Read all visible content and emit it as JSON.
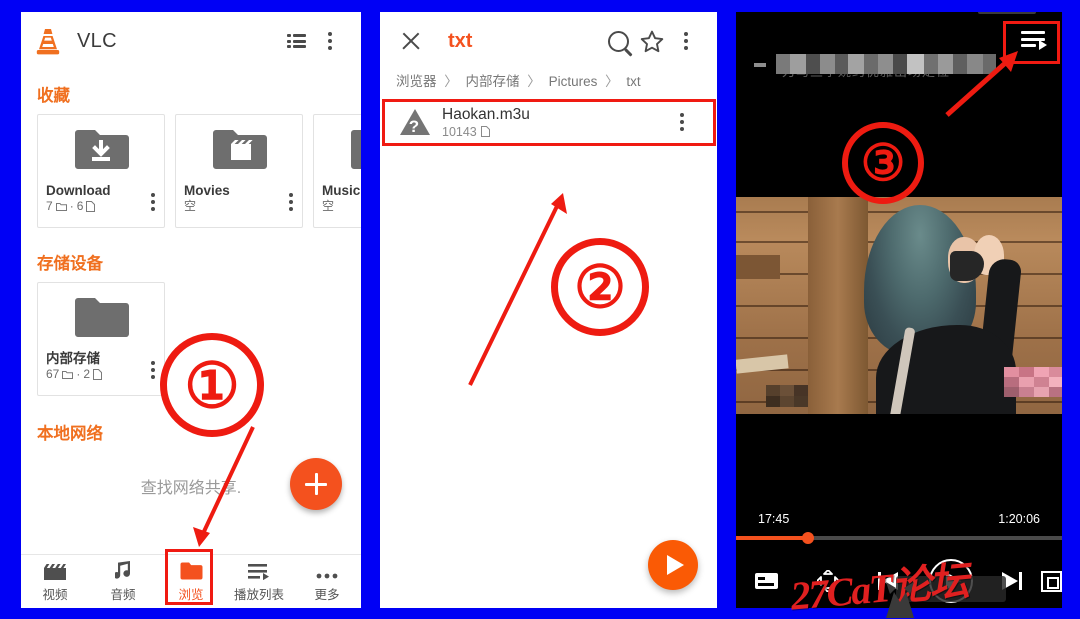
{
  "meta": {
    "background_color": "#0000f5",
    "accent_orange": "#f4511e",
    "annotation_red": "#ee1b11"
  },
  "panel1": {
    "name": "vlc-browse-screen",
    "appbar": {
      "app_name": "VLC",
      "logo_icon": "vlc-cone-icon",
      "list_view_icon": "list-view-icon",
      "overflow_icon": "more-vertical-icon"
    },
    "sections": [
      {
        "title": "收藏",
        "cards": [
          {
            "name": "Download",
            "subtitle": "7 □ · 6 □",
            "folders": "7",
            "files": "6",
            "icon": "folder-download-icon"
          },
          {
            "name": "Movies",
            "subtitle": "空",
            "icon": "folder-movie-icon"
          },
          {
            "name": "Music",
            "subtitle": "空",
            "icon": "folder-music-icon"
          }
        ]
      },
      {
        "title": "存储设备",
        "cards": [
          {
            "name": "内部存储",
            "subtitle": "67 □ · 2 □",
            "folders": "67",
            "files": "2",
            "icon": "folder-icon"
          }
        ]
      },
      {
        "title": "本地网络",
        "empty_text": "查找网络共享."
      }
    ],
    "fab": {
      "label": "+",
      "icon": "plus-icon"
    },
    "bottom_nav": [
      {
        "label": "视频",
        "icon": "video-icon",
        "active": false
      },
      {
        "label": "音频",
        "icon": "audio-icon",
        "active": false
      },
      {
        "label": "浏览",
        "icon": "folder-icon",
        "active": true
      },
      {
        "label": "播放列表",
        "icon": "playlist-icon",
        "active": false
      },
      {
        "label": "更多",
        "icon": "more-horizontal-icon",
        "active": false
      }
    ]
  },
  "panel2": {
    "name": "file-browser-screen",
    "appbar": {
      "close_icon": "close-icon",
      "title": "txt",
      "search_icon": "search-icon",
      "favorite_icon": "star-icon",
      "overflow_icon": "more-vertical-icon"
    },
    "breadcrumb": [
      "浏览器",
      "内部存储",
      "Pictures",
      "txt"
    ],
    "breadcrumb_separator": "〉",
    "files": [
      {
        "name": "Haokan.m3u",
        "size": "10143",
        "size_icon": "file-icon",
        "thumb_icon": "unknown-file-icon",
        "overflow_icon": "more-vertical-icon",
        "highlighted": true
      }
    ],
    "fab": {
      "icon": "play-icon"
    }
  },
  "panel3": {
    "name": "video-player-screen",
    "title_blurred": true,
    "title_placeholder": "",
    "playlist_icon": "playlist-play-icon",
    "playlist_highlighted": true,
    "time_current": "17:45",
    "time_total": "1:20:06",
    "progress_percent": 22,
    "controls": [
      {
        "icon": "subtitle-icon",
        "name": "subtitle-button"
      },
      {
        "icon": "aspect-ratio-icon",
        "name": "aspect-ratio-button"
      },
      {
        "icon": "previous-icon",
        "name": "previous-button"
      },
      {
        "icon": "play-icon",
        "name": "play-button"
      },
      {
        "icon": "next-icon",
        "name": "next-button"
      },
      {
        "icon": "lock-icon",
        "name": "lock-button"
      }
    ],
    "watermark": "27CaT论坛"
  },
  "annotations": {
    "steps": [
      {
        "number": "①",
        "target": "bottom-nav-browse"
      },
      {
        "number": "②",
        "target": "file-row-haokan"
      },
      {
        "number": "③",
        "target": "playlist-button"
      }
    ]
  }
}
